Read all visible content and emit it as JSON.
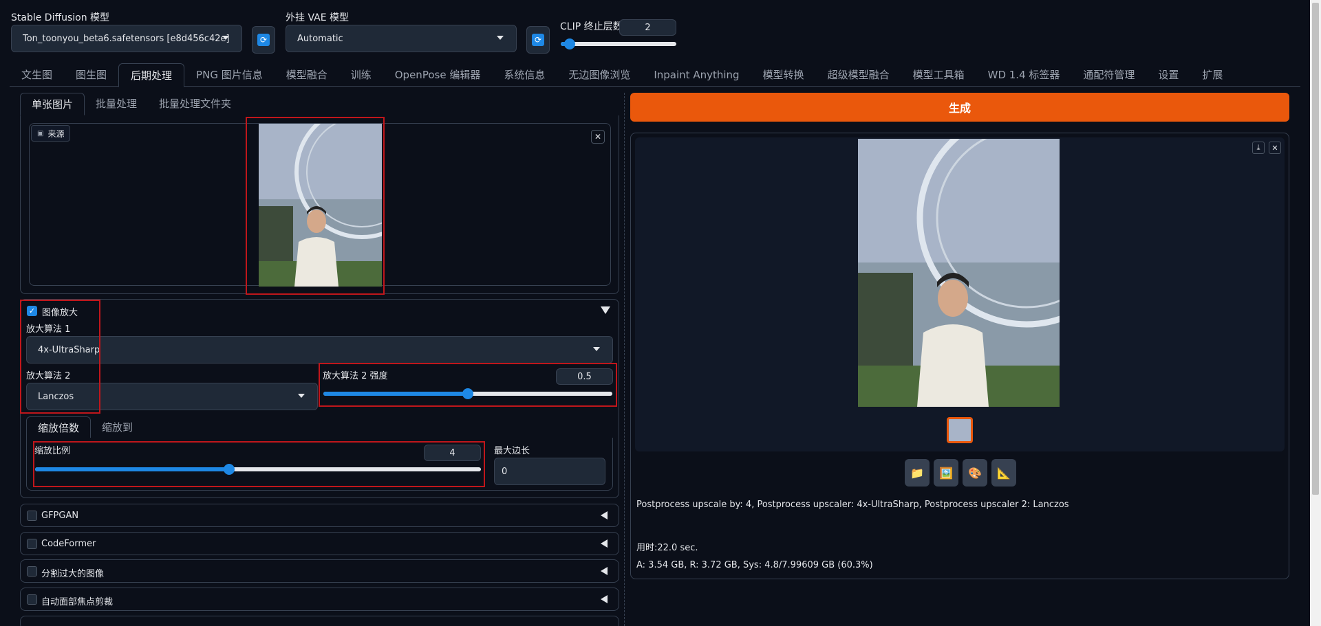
{
  "top": {
    "sd_model_label": "Stable Diffusion 模型",
    "sd_model_value": "Ton_toonyou_beta6.safetensors [e8d456c42e]",
    "vae_label": "外挂 VAE 模型",
    "vae_value": "Automatic",
    "clip_label": "CLIP 终止层数",
    "clip_value": "2",
    "clip_level": 0.08,
    "refresh_glyph": "⟳"
  },
  "tabs": [
    "文生图",
    "图生图",
    "后期处理",
    "PNG 图片信息",
    "模型融合",
    "训练",
    "OpenPose 编辑器",
    "系统信息",
    "无边图像浏览",
    "Inpaint Anything",
    "模型转换",
    "超级模型融合",
    "模型工具箱",
    "WD 1.4 标签器",
    "通配符管理",
    "设置",
    "扩展"
  ],
  "left": {
    "subtabs": [
      "单张图片",
      "批量处理",
      "批量处理文件夹"
    ],
    "source_label": "来源",
    "upscale_enabled_label": "图像放大",
    "upscaler1_label": "放大算法 1",
    "upscaler1_value": "4x-UltraSharp",
    "upscaler2_label": "放大算法 2",
    "upscaler2_value": "Lanczos",
    "upscaler2_strength_label": "放大算法 2 强度",
    "upscaler2_strength_value": "0.5",
    "upscaler2_strength_level": 0.5,
    "resize_tabs": [
      "缩放倍数",
      "缩放到"
    ],
    "scale_label": "缩放比例",
    "scale_value": "4",
    "scale_level": 0.435,
    "max_side_label": "最大边长",
    "max_side_value": "0",
    "accordions": [
      "GFPGAN",
      "CodeFormer",
      "分割过大的图像",
      "自动面部焦点剪裁"
    ]
  },
  "right": {
    "generate_label": "生成",
    "info_text": "Postprocess upscale by: 4, Postprocess upscaler: 4x-UltraSharp, Postprocess upscaler 2: Lanczos",
    "time_text": "用时:22.0 sec.",
    "mem_text": "A: 3.54 GB, R: 3.72 GB, Sys: 4.8/7.99609 GB (60.3%)",
    "tool_icons": [
      "📁",
      "🖼️",
      "🎨",
      "📐"
    ]
  },
  "colors": {
    "accent": "#1e88e5",
    "generate": "#ea580c",
    "highlight": "#c0161b"
  }
}
